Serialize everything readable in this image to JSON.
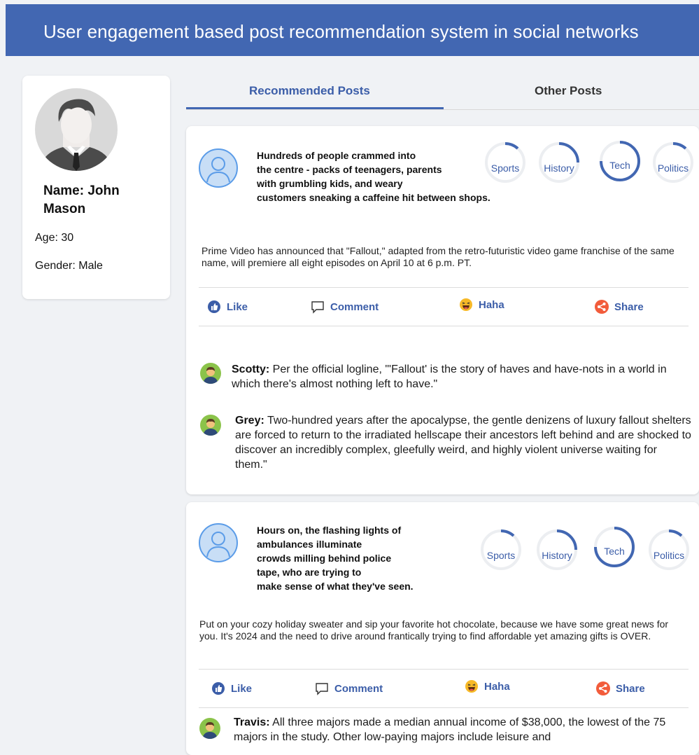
{
  "header": {
    "title": "User  engagement based post recommendation system in social networks"
  },
  "profile": {
    "name": "Name: John Mason",
    "age": "Age: 30",
    "gender": "Gender: Male"
  },
  "tabs": {
    "recommended": "Recommended Posts",
    "other": "Other Posts"
  },
  "categories": {
    "sports": "Sports",
    "history": "History",
    "tech": "Tech",
    "politics": "Politics"
  },
  "actions": {
    "like": "Like",
    "comment": "Comment",
    "haha": "Haha",
    "share": "Share"
  },
  "posts": [
    {
      "title": "Hundreds of people crammed into\nthe centre - packs of  teenagers, parents\nwith grumbling kids, and weary\ncustomers sneaking a caffeine hit between shops.",
      "text": "Prime Video has announced that \"Fallout,\" adapted from the retro-futuristic video game franchise of the same name, will premiere all eight episodes on April 10 at 6 p.m. PT.",
      "comments": [
        {
          "author": "Scotty:",
          "text": " Per the official logline, \"'Fallout' is the story of haves and have-nots in a world in which there's almost nothing left to have.\""
        },
        {
          "author": "Grey:",
          "text": " Two-hundred years after the apocalypse, the gentle denizens of luxury fallout  shelters are forced to return to the irradiated hellscape their ancestors left behind and are shocked to discover an incredibly complex, gleefully weird, and highly violent universe waiting for them.\""
        }
      ]
    },
    {
      "title": "Hours on, the flashing lights of\nambulances illuminate\ncrowds milling behind police\ntape, who are trying to\nmake sense of what they've seen.",
      "text": "Put on your cozy holiday sweater and sip your favorite hot chocolate, because we have some great news for you. It's 2024 and the need to drive around frantically trying to find affordable yet amazing gifts is OVER.",
      "comments": [
        {
          "author": "Travis:",
          "text": " All three majors made a median annual income of $38,000, the lowest of the 75 majors in the study. Other low-paying majors include leisure and"
        }
      ]
    }
  ],
  "colors": {
    "brand": "#4267b2",
    "link": "#3b5da8",
    "share": "#f25c3b",
    "haha": "#f7b928"
  }
}
